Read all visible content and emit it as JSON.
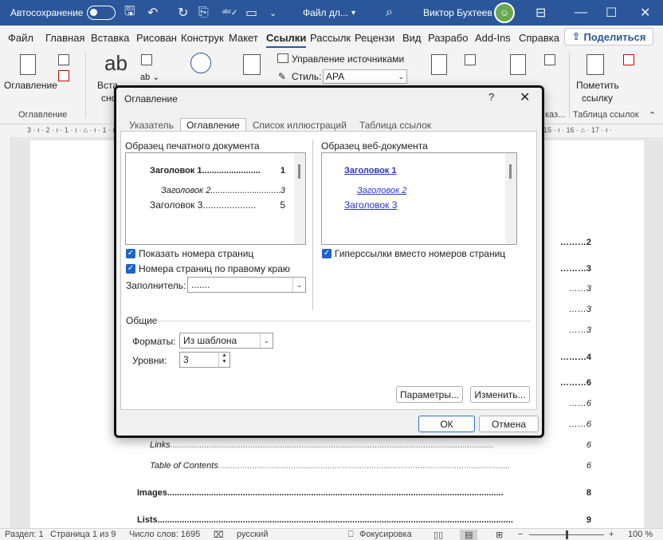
{
  "titlebar": {
    "autosave_label": "Автосохранение",
    "file_name": "Файл дл...",
    "user_name": "Виктор Бухтеев"
  },
  "menu": {
    "tabs": [
      "Файл",
      "Главная",
      "Вставка",
      "Рисован",
      "Конструк",
      "Макет",
      "Ссылки",
      "Рассылк",
      "Рецензи",
      "Вид",
      "Разрабо",
      "Add-Ins",
      "Справка"
    ],
    "active_tab": "Ссылки",
    "share_label": "Поделиться"
  },
  "ribbon": {
    "toc_button": "Оглавление",
    "toc_group": "Оглавление",
    "insert_fragment": "Вста",
    "snos_fragment": "сно",
    "manage_sources": "Управление источниками",
    "style_label": "Стиль:",
    "style_value": "APA",
    "mark_citation_line1": "Пометить",
    "mark_citation_line2": "ссылку",
    "citations_group": "Таблица ссылок",
    "kaz_fragment": "каз..."
  },
  "ruler": {
    "left_marks": "3 · ı · 2 · ı · 1 · ı · ⌂ · ı · 1 · ı ·",
    "right_marks": "15 · ı · 16 · ⌂ · 17 · ı ·"
  },
  "document": {
    "toc_visible": [
      {
        "text": "",
        "page": "2",
        "style": "bold"
      },
      {
        "text": "",
        "page": "3",
        "style": "bold"
      },
      {
        "text": "",
        "page": "3",
        "style": "ital"
      },
      {
        "text": "",
        "page": "3",
        "style": "ital"
      },
      {
        "text": "",
        "page": "3",
        "style": "ital"
      },
      {
        "text": "",
        "page": "4",
        "style": "bold"
      },
      {
        "text": "",
        "page": "6",
        "style": "bold"
      },
      {
        "text": "",
        "page": "6",
        "style": "ital"
      },
      {
        "text": "",
        "page": "6",
        "style": "ital"
      },
      {
        "text": "Links",
        "page": "6",
        "style": "ital"
      },
      {
        "text": "Table of Contents",
        "page": "6",
        "style": "ital"
      },
      {
        "text": "Images",
        "page": "8",
        "style": "bold"
      },
      {
        "text": "Lists",
        "page": "9",
        "style": "bold"
      }
    ]
  },
  "statusbar": {
    "section": "Раздел: 1",
    "page": "Страница 1 из 9",
    "words": "Число слов: 1695",
    "language": "русский",
    "focus": "Фокусировка",
    "zoom": "100 %"
  },
  "dialog": {
    "title": "Оглавление",
    "help": "?",
    "tabs": [
      "Указатель",
      "Оглавление",
      "Список иллюстраций",
      "Таблица ссылок"
    ],
    "active_tab": "Оглавление",
    "print_preview_label": "Образец печатного документа",
    "web_preview_label": "Образец веб-документа",
    "print_preview": [
      {
        "text": "Заголовок 1",
        "dots": "........................",
        "page": "1"
      },
      {
        "text": "Заголовок 2",
        "dots": ".................................",
        "page": "3"
      },
      {
        "text": "Заголовок 3",
        "dots": "....................",
        "page": "5"
      }
    ],
    "web_preview": [
      "Заголовок 1",
      "Заголовок 2",
      "Заголовок 3"
    ],
    "show_page_numbers": "Показать номера страниц",
    "right_align": "Номера страниц по правому краю",
    "hyperlinks": "Гиперссылки вместо номеров страниц",
    "leader_label": "Заполнитель:",
    "leader_value": ".......",
    "general_label": "Общие",
    "formats_label": "Форматы:",
    "formats_value": "Из шаблона",
    "levels_label": "Уровни:",
    "levels_value": "3",
    "params_button": "Параметры...",
    "modify_button": "Изменить...",
    "ok_button": "ОК",
    "cancel_button": "Отмена"
  },
  "colors": {
    "accent": "#2b579a",
    "checkbox": "#1f63c6",
    "link": "#2733d0"
  }
}
